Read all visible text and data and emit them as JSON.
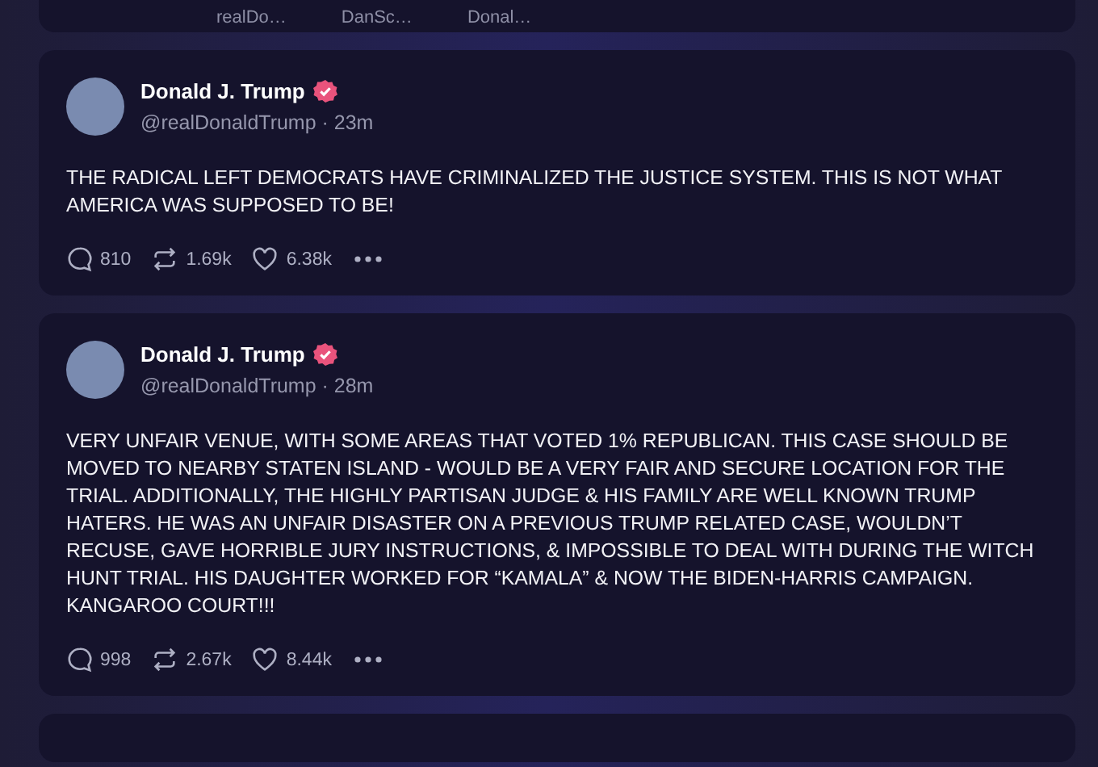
{
  "top_card": {
    "names": [
      "realDo…",
      "DanSc…",
      "Donal…"
    ]
  },
  "posts": [
    {
      "name": "Donald J. Trump",
      "verified": true,
      "handle": "@realDonaldTrump",
      "separator": "·",
      "time": "23m",
      "text": "THE RADICAL LEFT DEMOCRATS HAVE CRIMINALIZED THE JUSTICE SYSTEM. THIS IS NOT WHAT AMERICA WAS SUPPOSED TO BE!",
      "replies": "810",
      "reposts": "1.69k",
      "likes": "6.38k"
    },
    {
      "name": "Donald J. Trump",
      "verified": true,
      "handle": "@realDonaldTrump",
      "separator": "·",
      "time": "28m",
      "text": "VERY UNFAIR VENUE, WITH SOME AREAS THAT VOTED 1% REPUBLICAN. THIS CASE SHOULD BE MOVED TO NEARBY STATEN ISLAND - WOULD BE A VERY FAIR AND SECURE LOCATION FOR THE TRIAL. ADDITIONALLY, THE HIGHLY PARTISAN JUDGE & HIS FAMILY ARE WELL KNOWN TRUMP HATERS. HE WAS AN UNFAIR DISASTER ON A PREVIOUS TRUMP RELATED CASE, WOULDN’T RECUSE, GAVE HORRIBLE JURY INSTRUCTIONS, & IMPOSSIBLE TO DEAL WITH DURING THE WITCH HUNT TRIAL. HIS DAUGHTER WORKED FOR “KAMALA” & NOW THE BIDEN-HARRIS CAMPAIGN. KANGAROO COURT!!!",
      "replies": "998",
      "reposts": "2.67k",
      "likes": "8.44k"
    }
  ]
}
